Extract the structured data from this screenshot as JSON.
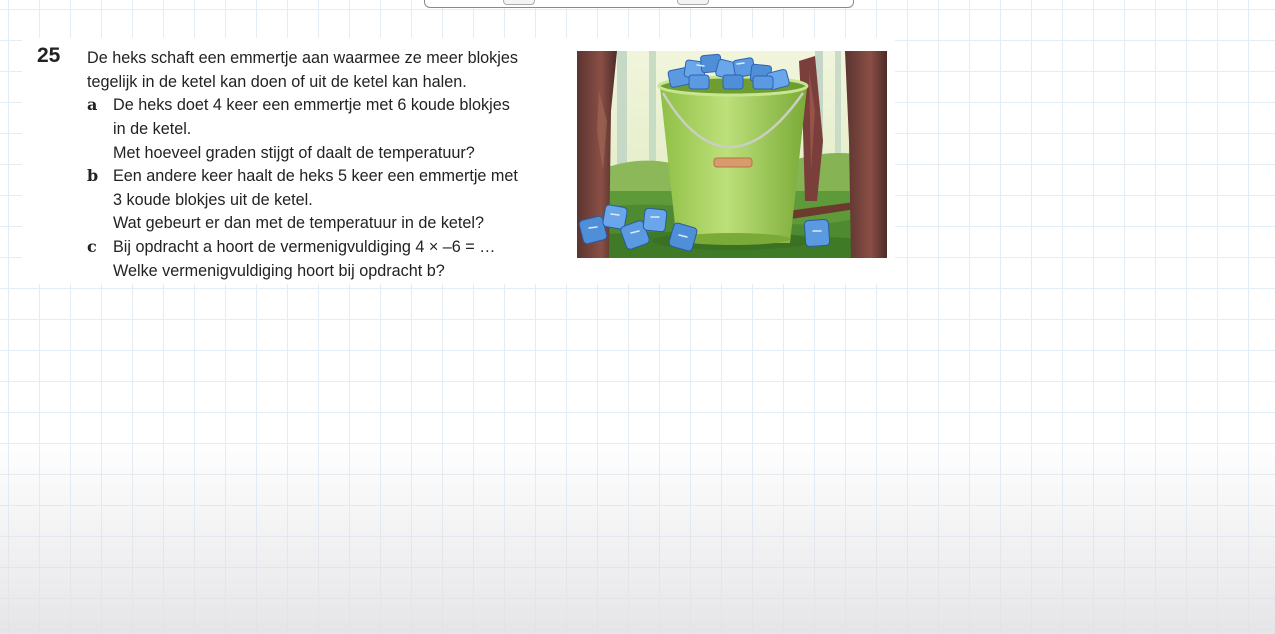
{
  "exercise": {
    "number": "25",
    "intro": [
      "De heks schaft een emmertje aan waarmee ze meer blokjes",
      "tegelijk in de ketel kan doen of uit de ketel kan halen."
    ],
    "parts": [
      {
        "letter": "a",
        "lines": [
          "De heks doet 4 keer een emmertje met 6 koude blokjes",
          "in de ketel.",
          "Met hoeveel graden stijgt of daalt de temperatuur?"
        ]
      },
      {
        "letter": "b",
        "lines": [
          "Een andere keer haalt de heks 5 keer een emmertje met",
          "3 koude blokjes uit de ketel.",
          "Wat gebeurt er dan met de temperatuur in de ketel?"
        ]
      },
      {
        "letter": "c",
        "lines": [
          "Bij opdracht a hoort de vermenigvuldiging 4 × –6 = …",
          "Welke vermenigvuldiging hoort bij opdracht b?"
        ]
      }
    ]
  },
  "illustration": {
    "icon": "bucket-with-ice-cubes-illustration"
  },
  "colors": {
    "grid": "#e3edf6",
    "bucket": "#a6cf5a",
    "ice": "#4f8fd8"
  }
}
